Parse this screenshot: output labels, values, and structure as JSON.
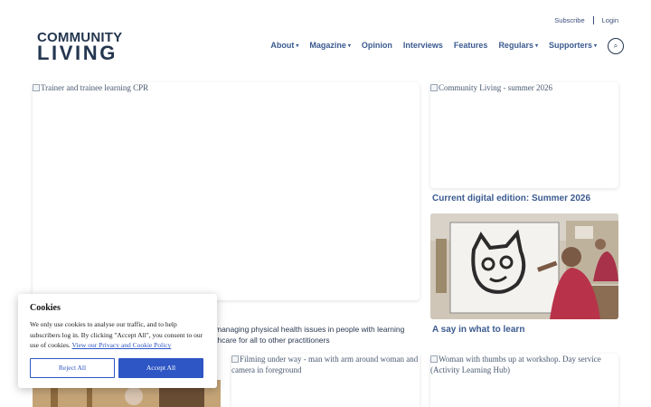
{
  "utility": {
    "subscribe": "Subscribe",
    "login": "Login"
  },
  "logo": {
    "line1": "COMMUNITY",
    "line2": "LIVING"
  },
  "nav": {
    "items": [
      {
        "label": "About",
        "dropdown": true
      },
      {
        "label": "Magazine",
        "dropdown": true
      },
      {
        "label": "Opinion",
        "dropdown": false
      },
      {
        "label": "Interviews",
        "dropdown": false
      },
      {
        "label": "Features",
        "dropdown": false
      },
      {
        "label": "Regulars",
        "dropdown": true
      },
      {
        "label": "Supporters",
        "dropdown": true
      }
    ],
    "caret": "▾",
    "search_icon": "⌕"
  },
  "feature": {
    "image_alt": "Trainer and trainee learning CPR",
    "excerpt_line1": "managing physical health issues in people with learning",
    "excerpt_line2": "thcare for all to other practitioners"
  },
  "edition": {
    "image_alt": "Community Living - summer 2026",
    "caption": "Current digital edition: Summer 2026"
  },
  "say": {
    "caption": "A say in what to learn"
  },
  "filming": {
    "image_alt": "Filming under way - man with arm around woman and camera in foreground"
  },
  "thumbs": {
    "image_alt": "Woman with thumbs up at workshop. Day service (Activity Learning Hub)"
  },
  "cookie": {
    "title": "Cookies",
    "text": "We only use cookies to analyse our traffic, and to help subscribers log in. By clicking \"Accept All\", you consent to our use of cookies.",
    "link": "View our Privacy and Cookie Policy",
    "reject": "Reject All",
    "accept": "Accept All"
  },
  "colors": {
    "navy": "#24364f",
    "link_blue": "#3b5a8f",
    "button_blue": "#2e56c4"
  }
}
